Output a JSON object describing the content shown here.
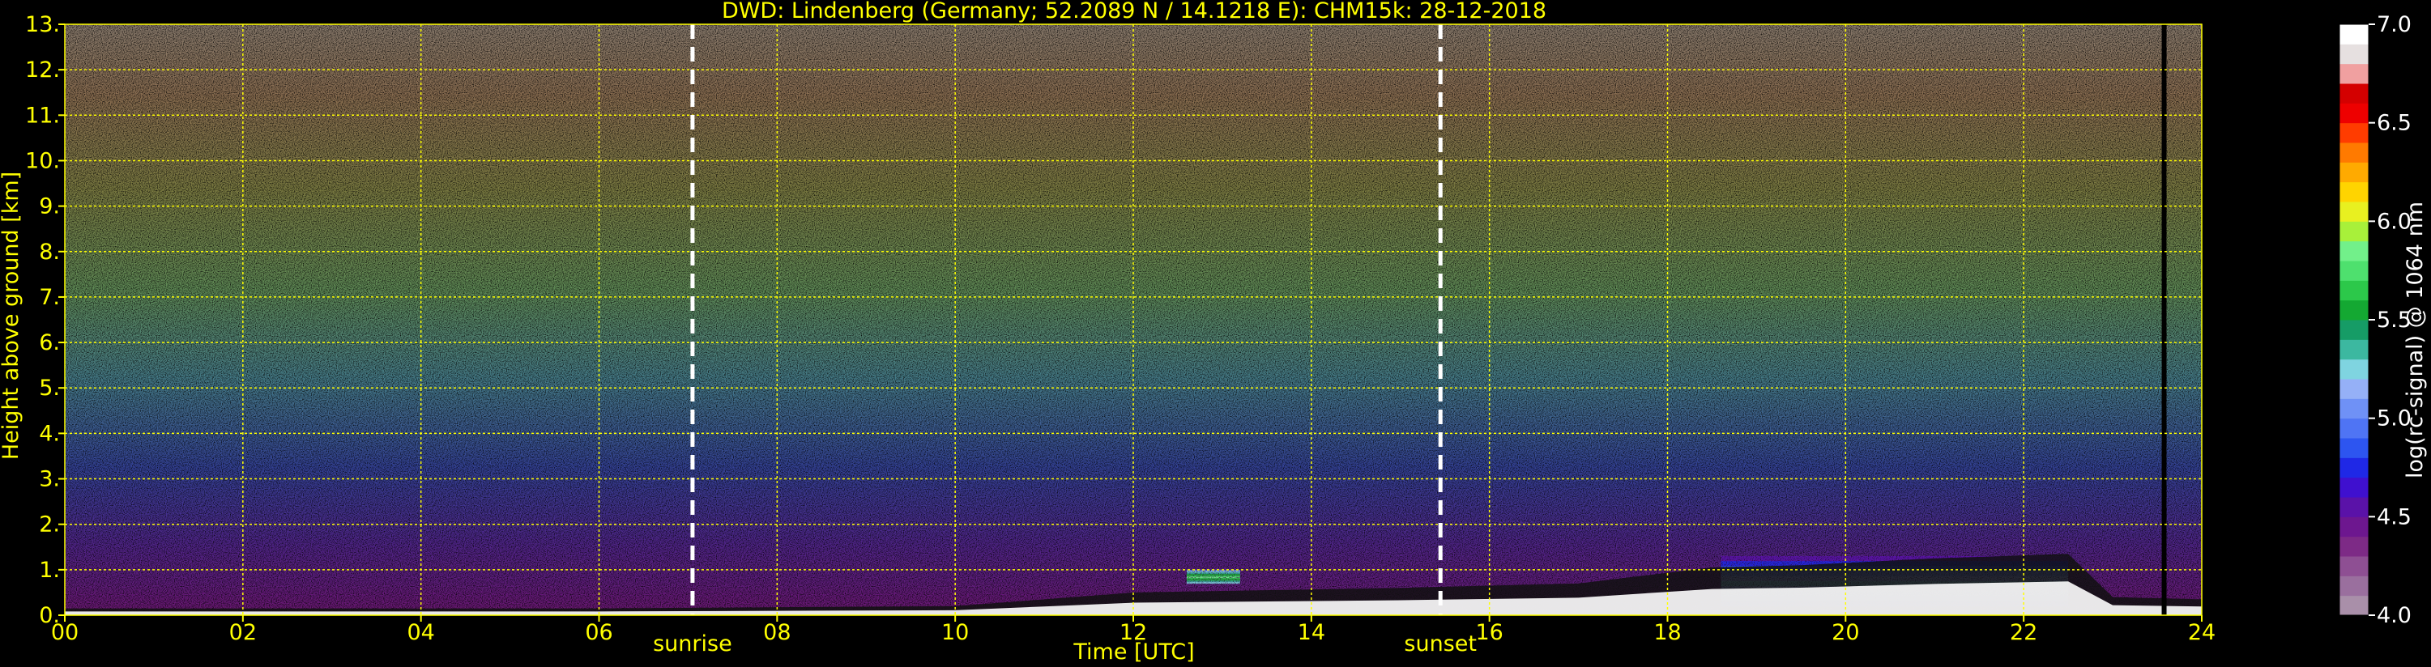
{
  "chart_data": {
    "type": "heatmap",
    "title": "DWD: Lindenberg (Germany; 52.2089 N / 14.1218 E):    CHM15k: 28-12-2018",
    "xlabel": "Time [UTC]",
    "ylabel": "Height above ground [km]",
    "xlim": [
      0,
      24
    ],
    "ylim": [
      0,
      13
    ],
    "x_ticks": [
      "00",
      "02",
      "04",
      "06",
      "08",
      "10",
      "12",
      "14",
      "16",
      "18",
      "20",
      "22",
      "24"
    ],
    "y_ticks": [
      "0.",
      "1.",
      "2.",
      "3.",
      "4.",
      "5.",
      "6.",
      "7.",
      "8.",
      "9.",
      "10.",
      "11.",
      "12.",
      "13."
    ],
    "grid": true,
    "markers": [
      {
        "label": "sunrise",
        "time": 7.05
      },
      {
        "label": "sunset",
        "time": 15.45
      }
    ],
    "colorbar": {
      "label": "log(rc-signal) @ 1064 nm",
      "min": 4.0,
      "max": 7.0,
      "ticks": [
        "4.0",
        "4.5",
        "5.0",
        "5.5",
        "6.0",
        "6.5",
        "7.0"
      ],
      "colors": [
        "#a98fa9",
        "#9a6f9e",
        "#8e4f93",
        "#7d2a86",
        "#6d178f",
        "#5a12a8",
        "#3f10cf",
        "#1f28e6",
        "#2d55f0",
        "#4f74f4",
        "#6f91f6",
        "#95b0f7",
        "#7fd4e0",
        "#3cb8a0",
        "#169c66",
        "#14a832",
        "#2cc84a",
        "#4ee06e",
        "#72f08a",
        "#a8f03a",
        "#e8f020",
        "#ffd400",
        "#ffaa00",
        "#ff7a00",
        "#ff3c00",
        "#ee0000",
        "#d40000",
        "#f0a0a0",
        "#e6e0e0",
        "#ffffff"
      ]
    },
    "boundary_layer_top_km": [
      {
        "time": 0,
        "height": 0.15
      },
      {
        "time": 6,
        "height": 0.15
      },
      {
        "time": 10,
        "height": 0.2
      },
      {
        "time": 11,
        "height": 0.35
      },
      {
        "time": 12,
        "height": 0.5
      },
      {
        "time": 15,
        "height": 0.6
      },
      {
        "time": 17,
        "height": 0.7
      },
      {
        "time": 18.5,
        "height": 1.05
      },
      {
        "time": 19.5,
        "height": 1.1
      },
      {
        "time": 21,
        "height": 1.25
      },
      {
        "time": 22.5,
        "height": 1.35
      },
      {
        "time": 23,
        "height": 0.4
      },
      {
        "time": 24,
        "height": 0.35
      }
    ],
    "cloud_layers": [
      {
        "start": 18.6,
        "end": 22.5,
        "base_km": 0.2,
        "top_km": 1.3,
        "peak": 5.3
      },
      {
        "start": 12.6,
        "end": 13.2,
        "base_km": 0.7,
        "top_km": 1.0,
        "peak": 5.8
      }
    ],
    "missing_data": [
      {
        "start": 23.55,
        "end": 23.6
      }
    ]
  }
}
